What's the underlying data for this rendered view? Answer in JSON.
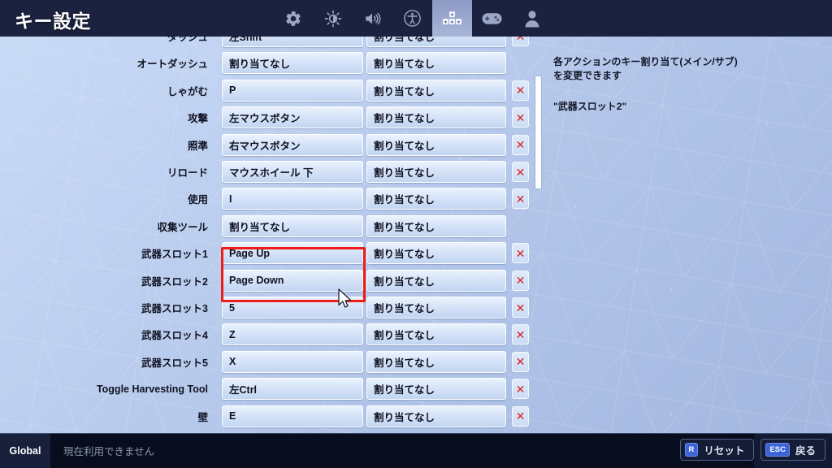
{
  "header": {
    "title": "キー設定",
    "nav_icons": [
      {
        "name": "gear-icon",
        "selected": false
      },
      {
        "name": "brightness-icon",
        "selected": false
      },
      {
        "name": "audio-icon",
        "selected": false
      },
      {
        "name": "accessibility-icon",
        "selected": false
      },
      {
        "name": "keyboard-keys-icon",
        "selected": true
      },
      {
        "name": "gamepad-icon",
        "selected": false
      },
      {
        "name": "account-icon",
        "selected": false
      }
    ]
  },
  "list": {
    "unassigned_label": "割り当てなし",
    "rows": [
      {
        "label": "ダッシュ",
        "primary": "左Shift",
        "secondary": "割り当てなし",
        "has_clear": true,
        "partial": true
      },
      {
        "label": "オートダッシュ",
        "primary": "割り当てなし",
        "secondary": "割り当てなし",
        "has_clear": false
      },
      {
        "label": "しゃがむ",
        "primary": "P",
        "secondary": "割り当てなし",
        "has_clear": true
      },
      {
        "label": "攻撃",
        "primary": "左マウスボタン",
        "secondary": "割り当てなし",
        "has_clear": true
      },
      {
        "label": "照準",
        "primary": "右マウスボタン",
        "secondary": "割り当てなし",
        "has_clear": true
      },
      {
        "label": "リロード",
        "primary": "マウスホイール 下",
        "secondary": "割り当てなし",
        "has_clear": true
      },
      {
        "label": "使用",
        "primary": "I",
        "secondary": "割り当てなし",
        "has_clear": true
      },
      {
        "label": "収集ツール",
        "primary": "割り当てなし",
        "secondary": "割り当てなし",
        "has_clear": false
      },
      {
        "label": "武器スロット1",
        "primary": "Page Up",
        "secondary": "割り当てなし",
        "has_clear": true
      },
      {
        "label": "武器スロット2",
        "primary": "Page Down",
        "secondary": "割り当てなし",
        "has_clear": true
      },
      {
        "label": "武器スロット3",
        "primary": "5",
        "secondary": "割り当てなし",
        "has_clear": true
      },
      {
        "label": "武器スロット4",
        "primary": "Z",
        "secondary": "割り当てなし",
        "has_clear": true
      },
      {
        "label": "武器スロット5",
        "primary": "X",
        "secondary": "割り当てなし",
        "has_clear": true
      },
      {
        "label": "Toggle Harvesting Tool",
        "primary": "左Ctrl",
        "secondary": "割り当てなし",
        "has_clear": true
      },
      {
        "label": "壁",
        "primary": "E",
        "secondary": "割り当てなし",
        "has_clear": true
      }
    ],
    "clear_icon": "✕"
  },
  "info": {
    "description": "各アクションのキー割り当て(メイン/サブ)を変更できます",
    "selected_action": "\"武器スロット2\""
  },
  "footer": {
    "tab_label": "Global",
    "status_text": "現在利用できません",
    "actions": [
      {
        "key": "R",
        "label": "リセット"
      },
      {
        "key": "ESC",
        "label": "戻る"
      }
    ]
  },
  "colors": {
    "header_bg": "#1b2240",
    "highlight_red": "#ee1b17",
    "clear_red": "#d81f20",
    "keycap_blue": "#3d63d8"
  }
}
